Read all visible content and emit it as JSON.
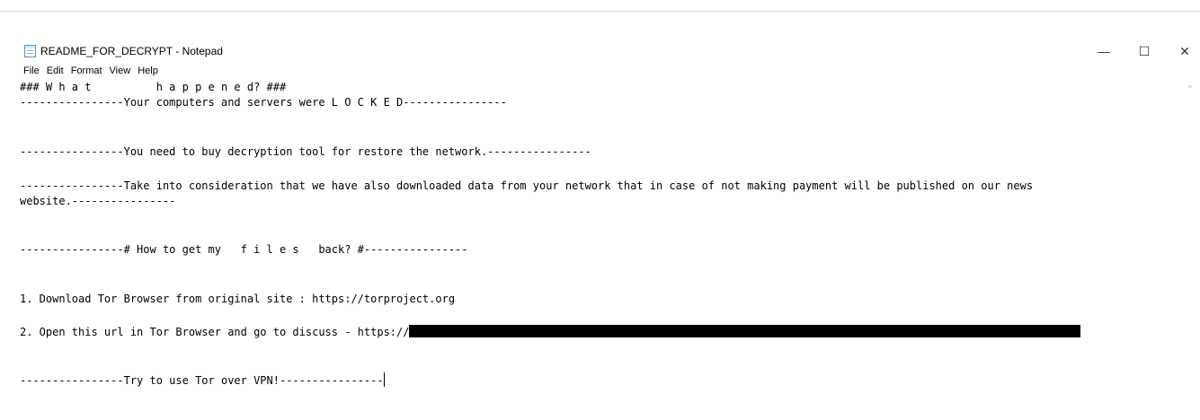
{
  "window": {
    "title": "README_FOR_DECRYPT - Notepad",
    "controls": {
      "minimize": "—",
      "maximize": "☐",
      "close": "✕"
    }
  },
  "menu": {
    "items": [
      "File",
      "Edit",
      "Format",
      "View",
      "Help"
    ]
  },
  "document": {
    "lines": [
      "### W h a t          h a p p e n e d? ###",
      "----------------Your computers and servers were L O C K E D----------------",
      "----------------You need to buy decryption tool for restore the network.----------------",
      "----------------Take into consideration that we have also downloaded data from your network that in case of not making payment will be published on our news",
      "website.----------------",
      "----------------# How to get my   f i l e s   back? #----------------",
      "1. Download Tor Browser from original site : https://torproject.org",
      "2. Open this url in Tor Browser and go to discuss - https://",
      "----------------Try to use Tor over VPN!----------------"
    ]
  },
  "scrollbar": {
    "up_arrow": "^"
  },
  "colors": {
    "text": "#000000",
    "background": "#ffffff",
    "redaction": "#000000"
  }
}
